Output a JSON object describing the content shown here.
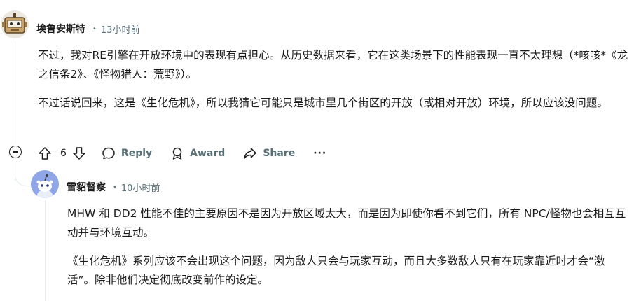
{
  "comment1": {
    "username": "埃鲁安斯特",
    "dot": "•",
    "time": "13小时前",
    "paragraphs": [
      "不过，我对RE引擎在开放环境中的表现有点担心。从历史数据来看，它在这类场景下的性能表现一直不太理想（*咳咳*《龙之信条2》、《怪物猎人：荒野》）。",
      "不过话说回来，这是《生化危机》，所以我猜它可能只是城市里几个街区的开放（或相对开放）环境，所以应该没问题。"
    ],
    "actions": {
      "vote_count": "6",
      "reply_label": "Reply",
      "award_label": "Award",
      "share_label": "Share",
      "more_label": "···"
    }
  },
  "comment2": {
    "username": "雪貂督察",
    "dot": "•",
    "time": "10小时前",
    "paragraphs": [
      "MHW 和 DD2 性能不佳的主要原因不是因为开放区域太大，而是因为即使你看不到它们，所有 NPC/怪物也会相互互动并与环境互动。",
      "《生化危机》系列应该不会出现这个问题，因为敌人只会与玩家互动，而且大多数敌人只有在玩家靠近时才会“激活”。除非他们决定彻底改变前作的设定。"
    ]
  },
  "icons": {
    "collapse": "collapse-minus-icon",
    "upvote": "upvote-arrow-icon",
    "downvote": "downvote-arrow-icon",
    "reply": "speech-bubble-icon",
    "award": "award-ribbon-icon",
    "share": "share-arrow-icon",
    "more": "ellipsis-icon"
  },
  "colors": {
    "meta_gray": "#576f76",
    "thread_line": "#e5ebee",
    "avatar2_bg": "#8fa7e8"
  }
}
